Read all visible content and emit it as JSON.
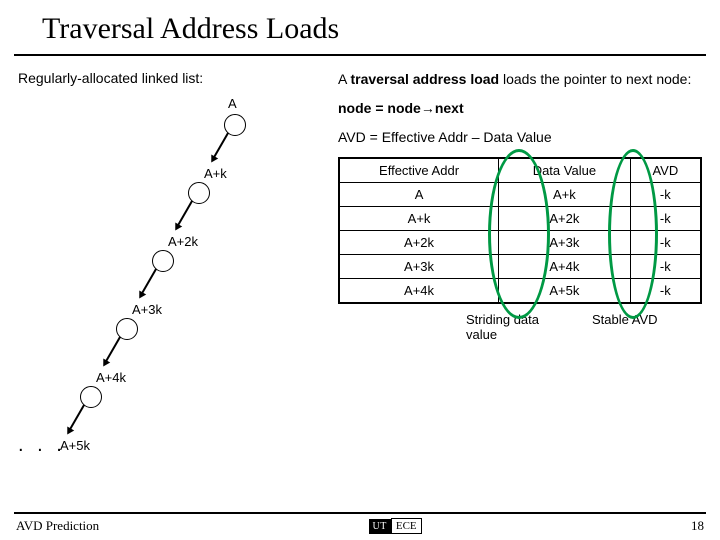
{
  "title": "Traversal Address Loads",
  "left": {
    "heading": "Regularly-allocated linked list:",
    "labels": [
      "A",
      "A+k",
      "A+2k",
      "A+3k",
      "A+4k",
      "A+5k"
    ],
    "ellipsis": ". . ."
  },
  "right": {
    "p1_pre": "A ",
    "p1_bold": "traversal address load",
    "p1_post": " loads the pointer to next node:",
    "code": "node = node→next",
    "formula": "AVD = Effective Addr – Data Value",
    "table": {
      "headers": [
        "Effective Addr",
        "Data Value",
        "AVD"
      ],
      "rows": [
        [
          "A",
          "A+k",
          "-k"
        ],
        [
          "A+k",
          "A+2k",
          "-k"
        ],
        [
          "A+2k",
          "A+3k",
          "-k"
        ],
        [
          "A+3k",
          "A+4k",
          "-k"
        ],
        [
          "A+4k",
          "A+5k",
          "-k"
        ]
      ]
    },
    "cap1": "Striding data value",
    "cap2": "Stable AVD"
  },
  "footer": {
    "left": "AVD Prediction",
    "logo_ut": "UT",
    "logo_ece": "ECE",
    "page": "18"
  },
  "chart_data": {
    "type": "table",
    "title": "Traversal Address Load AVD",
    "headers": [
      "Effective Addr",
      "Data Value",
      "AVD"
    ],
    "rows": [
      [
        "A",
        "A+k",
        "-k"
      ],
      [
        "A+k",
        "A+2k",
        "-k"
      ],
      [
        "A+2k",
        "A+3k",
        "-k"
      ],
      [
        "A+3k",
        "A+4k",
        "-k"
      ],
      [
        "A+4k",
        "A+5k",
        "-k"
      ]
    ],
    "column_annotations": [
      "",
      "Striding data value",
      "Stable AVD"
    ]
  }
}
